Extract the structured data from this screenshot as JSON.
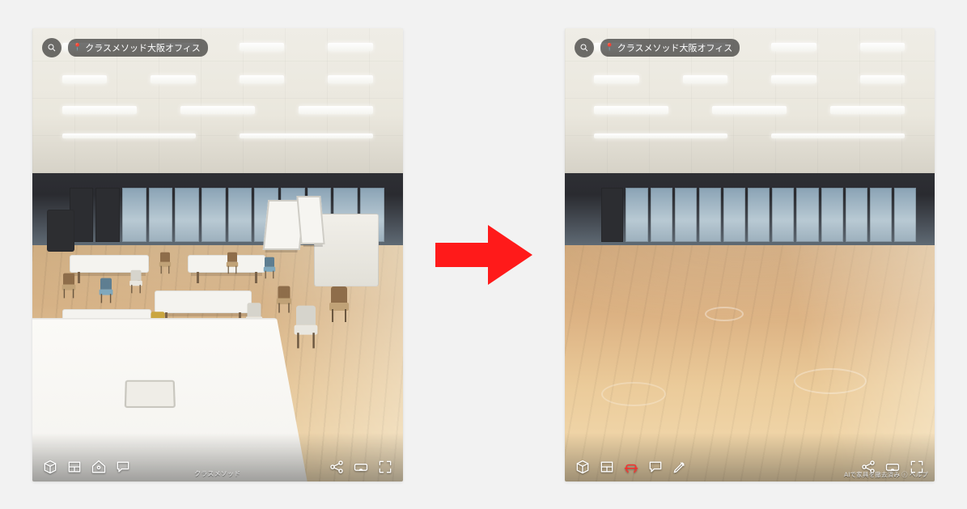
{
  "panels": {
    "left": {
      "location_label": "クラスメソッド大阪オフィス",
      "footer_text": "クラスメソッド"
    },
    "right": {
      "location_label": "クラスメソッド大阪オフィス",
      "footer_text_right": "AIで家具を撤去済み ⓘ ヘルプ"
    }
  },
  "icons": {
    "search": "search-icon",
    "pin": "pin-icon",
    "explore": "explore-icon",
    "floorplan": "floorplan-icon",
    "tag": "tag-icon",
    "comment": "comment-icon",
    "pencil": "pencil-icon",
    "share": "share-icon",
    "vr": "vr-icon",
    "fullscreen": "fullscreen-icon",
    "defurnish": "defurnish-icon"
  },
  "arrow": {
    "color": "#ff1a1a"
  }
}
